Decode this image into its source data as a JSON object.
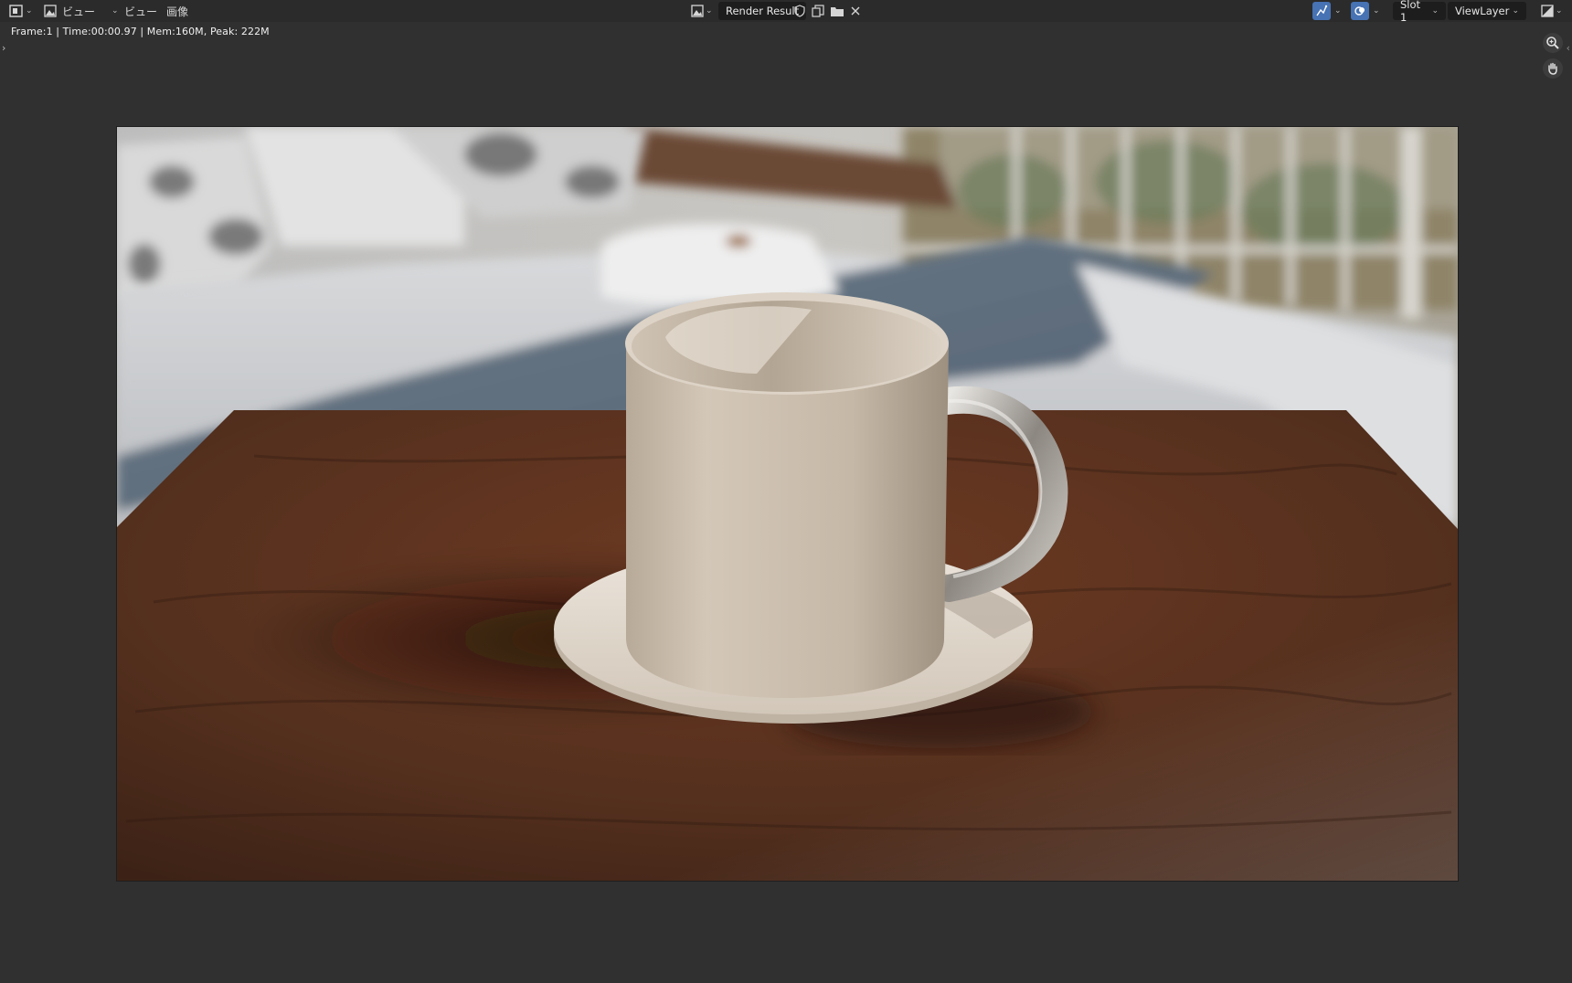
{
  "header": {
    "editor_type_icon": "image-editor-icon",
    "view_menu_1": "ビュー",
    "view_menu_2": "ビュー",
    "image_menu": "画像",
    "image_name": "Render Result",
    "slot": "Slot 1",
    "view_layer": "ViewLayer"
  },
  "status": {
    "text": "Frame:1 | Time:00:00.97 | Mem:160M, Peak: 222M"
  },
  "colors": {
    "background": "#303030",
    "header": "#2b2b2b",
    "accent_blue": "#4772b3"
  },
  "render": {
    "description_icon": "render-result-image"
  }
}
